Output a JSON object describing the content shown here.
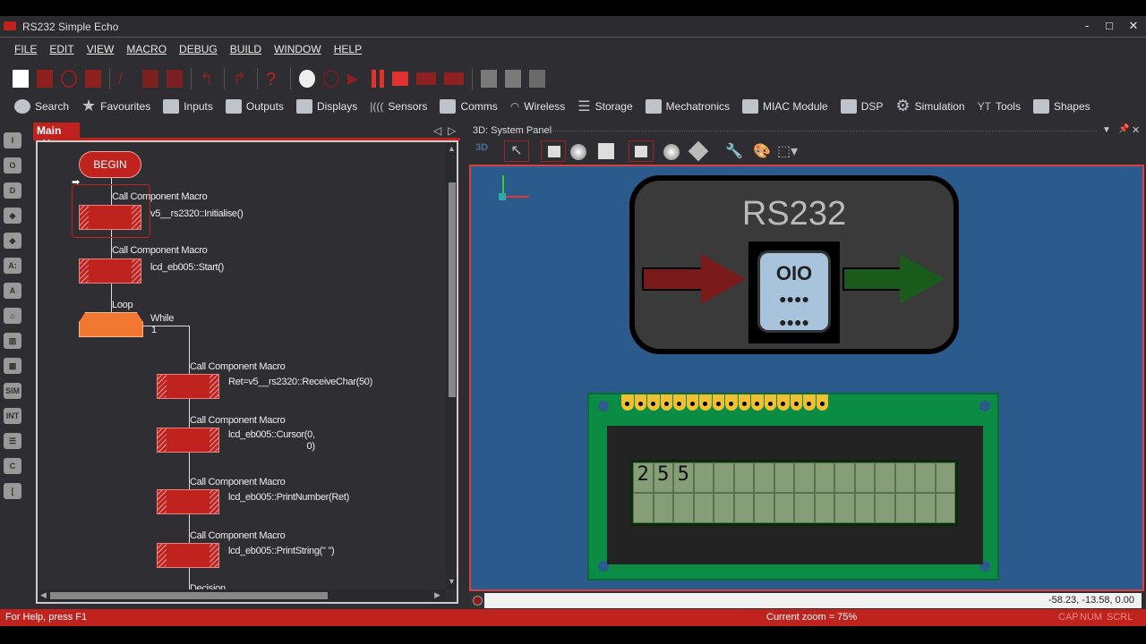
{
  "window": {
    "title": "RS232 Simple Echo",
    "minimize": "-",
    "maximize": "□",
    "close": "✕"
  },
  "menu": [
    "FILE",
    "EDIT",
    "VIEW",
    "MACRO",
    "DEBUG",
    "BUILD",
    "WINDOW",
    "HELP"
  ],
  "components": [
    "Search",
    "Favourites",
    "Inputs",
    "Outputs",
    "Displays",
    "Sensors",
    "Comms",
    "Wireless",
    "Storage",
    "Mechatronics",
    "MIAC Module",
    "DSP",
    "Simulation",
    "Tools",
    "Shapes"
  ],
  "left_icons": [
    "I",
    "O",
    "D",
    "◆",
    "◆",
    "A:",
    "A",
    "⌂",
    "▥",
    "▦",
    "SIM",
    "INT",
    "☰",
    "C",
    "[ "
  ],
  "main": {
    "tab": "Main",
    "close": "✕",
    "flow": {
      "begin": "BEGIN",
      "call_label": "Call Component Macro",
      "loop": "Loop",
      "while": "While",
      "while_cond": "1",
      "decision": "Decision",
      "calls": [
        "v5__rs2320::Initialise()",
        "lcd_eb005::Start()",
        "Ret=v5__rs2320::ReceiveChar(50)",
        "lcd_eb005::Cursor(0,\n0)",
        "lcd_eb005::PrintNumber(Ret)",
        "lcd_eb005::PrintString(\" \")"
      ]
    }
  },
  "panel3d": {
    "title": "3D: System Panel",
    "mode": "3D",
    "rs232_label": "RS232",
    "lcd_text": [
      "2",
      "5",
      "5"
    ],
    "coords": "-58.23, -13.58, 0.00"
  },
  "status": {
    "help": "For Help, press F1",
    "zoom": "Current zoom = 75%",
    "cap": "CAP",
    "num": "NUM",
    "scrl": "SCRL"
  }
}
